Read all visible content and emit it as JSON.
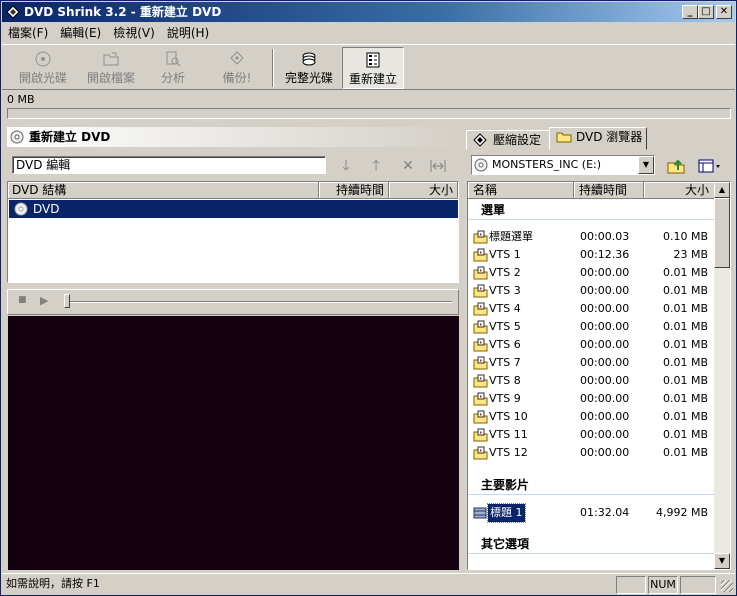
{
  "window": {
    "title": "DVD Shrink 3.2 - 重新建立 DVD",
    "minimize": "_",
    "maximize": "□",
    "close": "✕"
  },
  "menu": [
    "檔案(F)",
    "編輯(E)",
    "檢視(V)",
    "說明(H)"
  ],
  "toolbar": {
    "open_disc": "開啟光碟",
    "open_files": "開啟檔案",
    "analyze": "分析",
    "backup": "備份!",
    "full_disc": "完整光碟",
    "re_author": "重新建立"
  },
  "size_label": "0 MB",
  "left_panel": {
    "title": "重新建立 DVD",
    "edit_value": "DVD 編輯",
    "columns": {
      "structure": "DVD 結構",
      "duration": "持續時間",
      "size": "大小"
    },
    "tree": [
      {
        "label": "DVD"
      }
    ]
  },
  "right_panel": {
    "tabs": {
      "compression": "壓縮設定",
      "browser": "DVD 瀏覽器"
    },
    "drive": "MONSTERS_INC (E:)",
    "columns": {
      "name": "名稱",
      "duration": "持續時間",
      "size": "大小"
    },
    "sections": {
      "menus": "選單",
      "main_movie": "主要影片",
      "extras": "其它選項"
    },
    "menu_rows": [
      {
        "name": "標題選單",
        "duration": "00:00.03",
        "size": "0.10 MB"
      },
      {
        "name": "VTS 1",
        "duration": "00:12.36",
        "size": "23 MB"
      },
      {
        "name": "VTS 2",
        "duration": "00:00.00",
        "size": "0.01 MB"
      },
      {
        "name": "VTS 3",
        "duration": "00:00.00",
        "size": "0.01 MB"
      },
      {
        "name": "VTS 4",
        "duration": "00:00.00",
        "size": "0.01 MB"
      },
      {
        "name": "VTS 5",
        "duration": "00:00.00",
        "size": "0.01 MB"
      },
      {
        "name": "VTS 6",
        "duration": "00:00.00",
        "size": "0.01 MB"
      },
      {
        "name": "VTS 7",
        "duration": "00:00.00",
        "size": "0.01 MB"
      },
      {
        "name": "VTS 8",
        "duration": "00:00.00",
        "size": "0.01 MB"
      },
      {
        "name": "VTS 9",
        "duration": "00:00.00",
        "size": "0.01 MB"
      },
      {
        "name": "VTS 10",
        "duration": "00:00.00",
        "size": "0.01 MB"
      },
      {
        "name": "VTS 11",
        "duration": "00:00.00",
        "size": "0.01 MB"
      },
      {
        "name": "VTS 12",
        "duration": "00:00.00",
        "size": "0.01 MB"
      }
    ],
    "main_rows": [
      {
        "name": "標題 1",
        "duration": "01:32.04",
        "size": "4,992 MB"
      }
    ]
  },
  "status": {
    "help": "如需說明，請按 F1",
    "num": "NUM"
  }
}
